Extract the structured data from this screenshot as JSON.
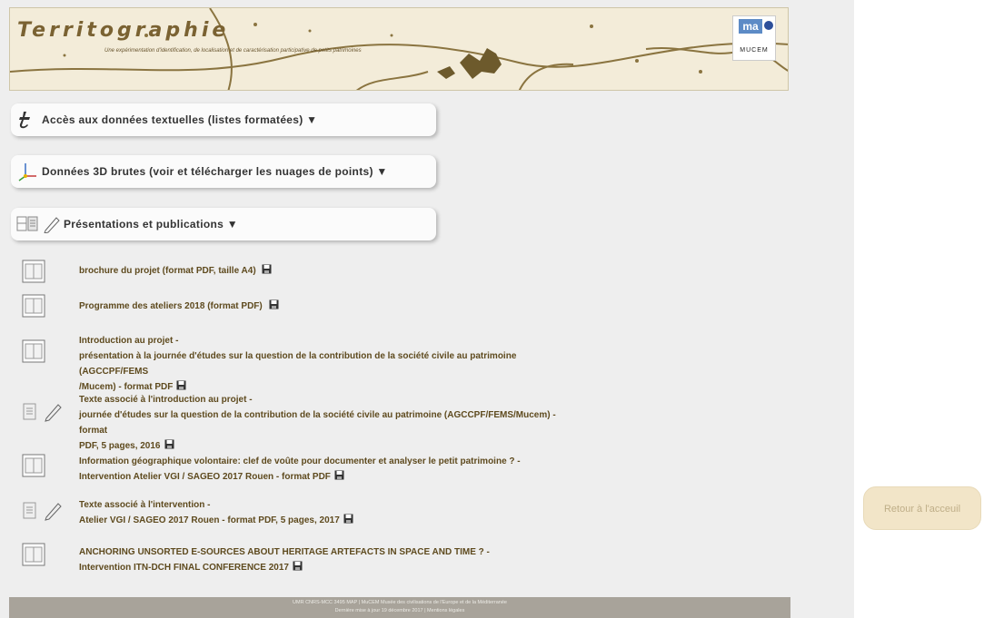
{
  "banner": {
    "title": "Territographie",
    "subtitle": "Une expérimentation d'identification, de localisation et de caractérisation participative de petits patrimoines",
    "logo_map": "ma",
    "logo_mucem": "MUCEM"
  },
  "sections": [
    {
      "label": "Accès aux données textuelles (listes formatées) ▼",
      "icon": "text-t-icon"
    },
    {
      "label": "Données 3D brutes (voir et télécharger les nuages de points) ▼",
      "icon": "axes-3d-icon"
    },
    {
      "label": "Présentations et publications ▼",
      "icon": "film-pencil-icon"
    }
  ],
  "publications": [
    {
      "icon": "film-icon",
      "lines": [
        "brochure du projet (format PDF, taille A4)"
      ]
    },
    {
      "icon": "film-icon",
      "lines": [
        "Programme des ateliers 2018 (format PDF)"
      ]
    },
    {
      "icon": "film-icon",
      "lines": [
        "Introduction au projet -",
        "présentation à la journée d'études sur la question de la contribution de la société civile au patrimoine (AGCCPF/FEMS",
        "/Mucem) - format PDF"
      ]
    },
    {
      "icon": "doc-pencil-icon",
      "lines": [
        "Texte associé à l'introduction au projet -",
        "journée d'études sur la question de la contribution de la société civile au patrimoine (AGCCPF/FEMS/Mucem) - format",
        "PDF, 5 pages, 2016"
      ]
    },
    {
      "icon": "film-icon",
      "lines": [
        "Information géographique volontaire: clef de voûte pour documenter et analyser le petit patrimoine ? -",
        "Intervention Atelier VGI / SAGEO 2017 Rouen - format PDF"
      ]
    },
    {
      "icon": "doc-pencil-icon",
      "lines": [
        "Texte associé à l'intervention -",
        "Atelier VGI / SAGEO 2017 Rouen - format PDF, 5 pages, 2017"
      ]
    },
    {
      "icon": "film-icon",
      "lines": [
        "ANCHORING UNSORTED E-SOURCES ABOUT HERITAGE ARTEFACTS IN SPACE AND TIME ? -",
        "Intervention ITN-DCH FINAL CONFERENCE 2017"
      ]
    }
  ],
  "footer": {
    "line1": "UMR CNRS-MCC 3495 MAP | MuCEM Musée des civilisations de l'Europe et de la Méditerranée",
    "line2": "Dernière mise à jour 19 décembre 2017 | Mentions légales"
  },
  "back_button": "Retour à l'acceuil"
}
